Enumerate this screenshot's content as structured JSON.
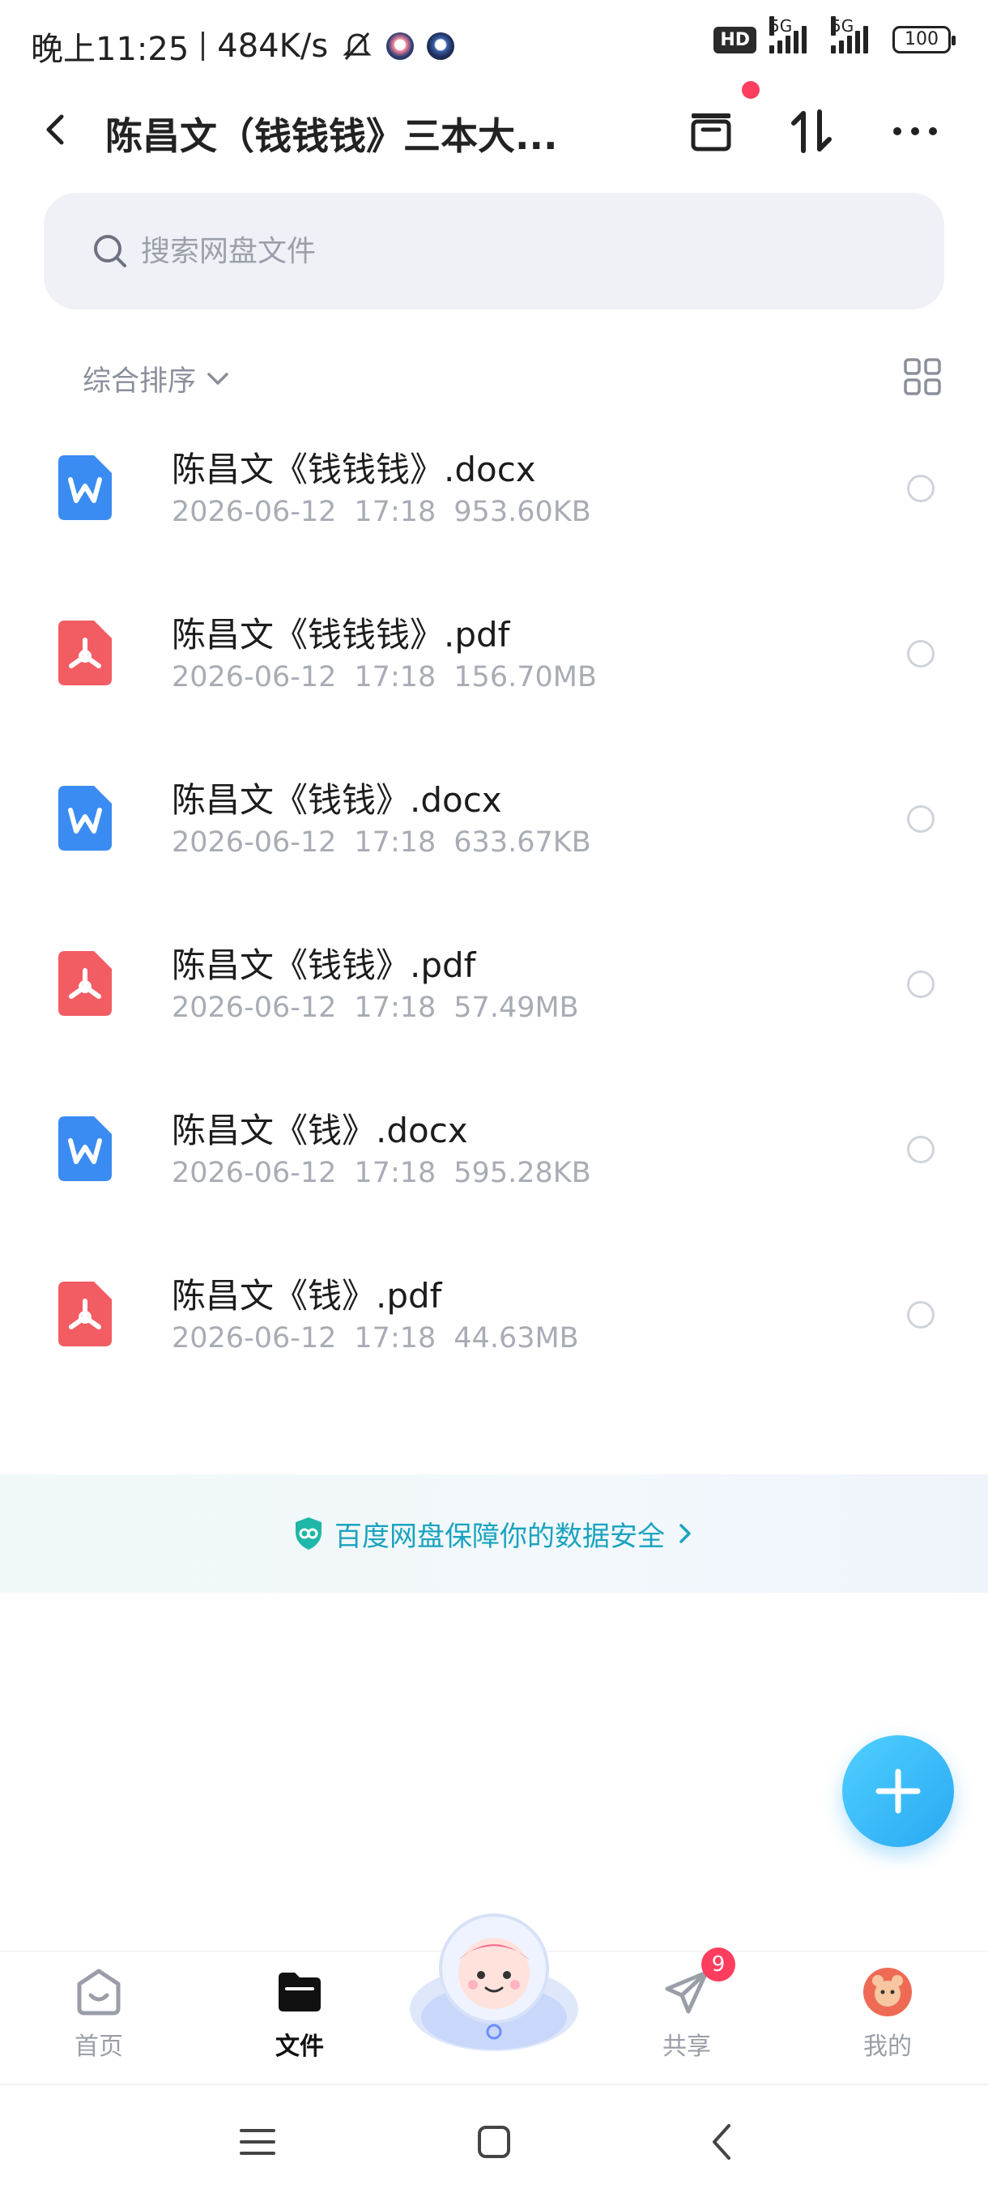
{
  "status_bar": {
    "time": "晚上11:25",
    "speed": "484K/s",
    "hd_label": "HD",
    "hd_sub": "1/2",
    "network1": "5G",
    "network2": "5G",
    "battery": "100"
  },
  "header": {
    "title": "陈昌文（钱钱钱》三本大...",
    "icons": [
      "back-arrow",
      "archive-box",
      "sort-arrows",
      "more-dots"
    ]
  },
  "search": {
    "placeholder": "搜索网盘文件"
  },
  "sort": {
    "label": "综合排序"
  },
  "files": [
    {
      "name": "陈昌文《钱钱钱》.docx",
      "date": "2026-06-12",
      "time": "17:18",
      "size": "953.60KB",
      "type": "word"
    },
    {
      "name": "陈昌文《钱钱钱》.pdf",
      "date": "2026-06-12",
      "time": "17:18",
      "size": "156.70MB",
      "type": "pdf"
    },
    {
      "name": "陈昌文《钱钱》.docx",
      "date": "2026-06-12",
      "time": "17:18",
      "size": "633.67KB",
      "type": "word"
    },
    {
      "name": "陈昌文《钱钱》.pdf",
      "date": "2026-06-12",
      "time": "17:18",
      "size": "57.49MB",
      "type": "pdf"
    },
    {
      "name": "陈昌文《钱》.docx",
      "date": "2026-06-12",
      "time": "17:18",
      "size": "595.28KB",
      "type": "word"
    },
    {
      "name": "陈昌文《钱》.pdf",
      "date": "2026-06-12",
      "time": "17:18",
      "size": "44.63MB",
      "type": "pdf"
    }
  ],
  "security_banner": {
    "text": "百度网盘保障你的数据安全"
  },
  "bottom_nav": {
    "items": [
      {
        "label": "首页",
        "icon": "home-icon"
      },
      {
        "label": "文件",
        "icon": "folder-icon",
        "active": true
      },
      {
        "label": "共享",
        "icon": "share-plane-icon"
      },
      {
        "label": "我的",
        "icon": "avatar-icon"
      }
    ],
    "share_badge": "9"
  },
  "colors": {
    "accent": "#2aa8f3",
    "word_blue": "#3b8cf2",
    "pdf_red": "#f25c63",
    "badge_red": "#ff3d5e",
    "banner_text": "#1aa3bf"
  }
}
